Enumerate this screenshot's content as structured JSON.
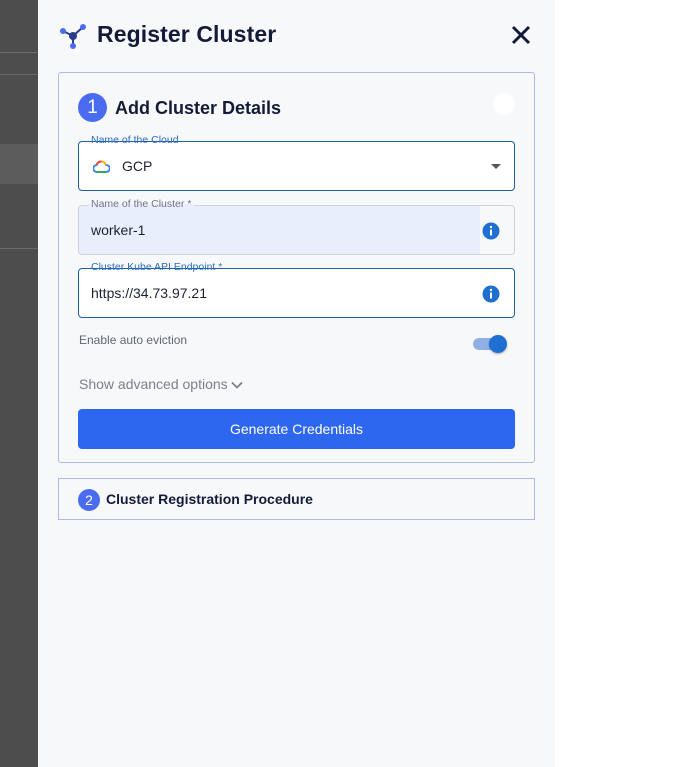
{
  "drawer": {
    "title": "Register Cluster"
  },
  "step1": {
    "number": "1",
    "title": "Add Cluster Details",
    "cloud_field": {
      "label": "Name of the Cloud",
      "value": "GCP"
    },
    "cluster_name_field": {
      "label": "Name of the Cluster *",
      "value": "worker-1"
    },
    "endpoint_field": {
      "label": "Cluster Kube API Endpoint *",
      "value": "https://34.73.97.21"
    },
    "auto_eviction": {
      "label": "Enable auto eviction",
      "enabled": true
    },
    "advanced_label": "Show advanced options",
    "generate_button": "Generate Credentials"
  },
  "step2": {
    "number": "2",
    "title": "Cluster Registration Procedure"
  },
  "colors": {
    "primary": "#2d66ef",
    "badge": "#4a6cf0",
    "title_text": "#141b38",
    "backdrop": "#4d4d4d"
  },
  "icons": {
    "logo": "cluster-logo-icon",
    "close": "close-icon",
    "cloud": "gcp-cloud-icon",
    "info": "info-icon",
    "dropdown": "caret-down-icon",
    "advanced": "chevron-down-icon"
  }
}
